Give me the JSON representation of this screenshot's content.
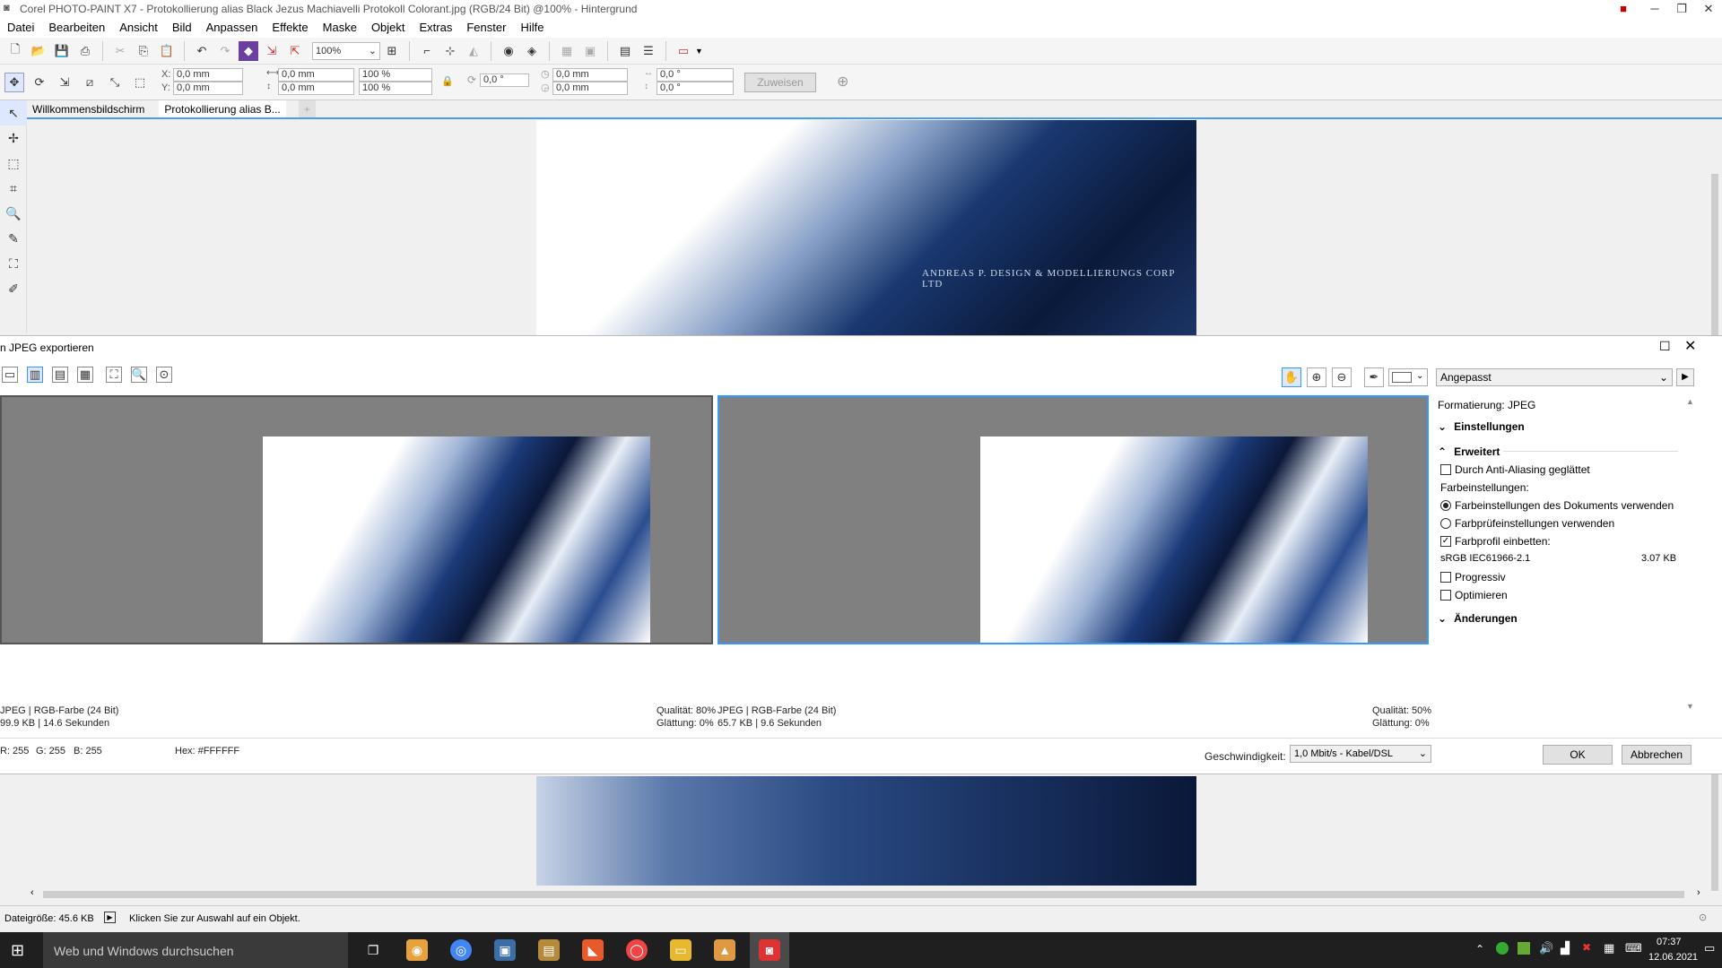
{
  "window": {
    "title": "Corel PHOTO-PAINT X7 - Protokollierung alias Black Jezus Machiavelli Protokoll Colorant.jpg (RGB/24 Bit) @100% - Hintergrund"
  },
  "menu": [
    "Datei",
    "Bearbeiten",
    "Ansicht",
    "Bild",
    "Anpassen",
    "Effekte",
    "Maske",
    "Objekt",
    "Extras",
    "Fenster",
    "Hilfe"
  ],
  "toolbar": {
    "zoom": "100%",
    "x": "0,0 mm",
    "y": "0,0 mm",
    "w": "0,0 mm",
    "h": "0,0 mm",
    "scale_w": "100 %",
    "scale_h": "100 %",
    "angle": "0,0 °",
    "cx": "0,0 mm",
    "cy": "0,0 mm",
    "skew_h": "0,0 °",
    "skew_v": "0,0 °",
    "assign_label": "Zuweisen"
  },
  "tabs": [
    "Willkommensbildschirm",
    "Protokollierung alias B..."
  ],
  "watermark": "ANDREAS P. DESIGN & MODELLIERUNGS CORP LTD",
  "dialog": {
    "title": "n JPEG exportieren",
    "preset": "Angepasst",
    "left_info": {
      "line1": "JPEG  |  RGB-Farbe (24 Bit)",
      "line2": "99.9 KB  |  14.6 Sekunden",
      "q": "Qualität: 80%",
      "g": "Glättung: 0%"
    },
    "right_info": {
      "line1": "JPEG  |  RGB-Farbe (24 Bit)",
      "line2": "65.7 KB  |  9.6 Sekunden",
      "q": "Qualität: 50%",
      "g": "Glättung: 0%"
    },
    "format_label": "Formatierung: JPEG",
    "sec_settings": "Einstellungen",
    "sec_advanced": "Erweitert",
    "antialias": "Durch Anti-Aliasing geglättet",
    "color_settings": "Farbeinstellungen:",
    "radio_doc": "Farbeinstellungen des Dokuments verwenden",
    "radio_proof": "Farbprüfeinstellungen verwenden",
    "embed_profile": "Farbprofil einbetten:",
    "profile_name": "sRGB IEC61966-2.1",
    "profile_size": "3.07 KB",
    "progressive": "Progressiv",
    "optimize": "Optimieren",
    "sec_changes": "Änderungen",
    "r": "R: 255",
    "g": "G: 255",
    "b": "B: 255",
    "hex": "Hex: #FFFFFF",
    "speed_label": "Geschwindigkeit:",
    "speed_value": "1,0 Mbit/s - Kabel/DSL",
    "ok": "OK",
    "cancel": "Abbrechen"
  },
  "status": {
    "filesize": "Dateigröße: 45.6 KB",
    "hint": "Klicken Sie zur Auswahl auf ein Objekt."
  },
  "taskbar": {
    "search": "Web und Windows durchsuchen",
    "time": "07:37",
    "date": "12.06.2021"
  },
  "colors": {
    "accent": "#3399ff",
    "taskbar": "#1f1f1f"
  }
}
